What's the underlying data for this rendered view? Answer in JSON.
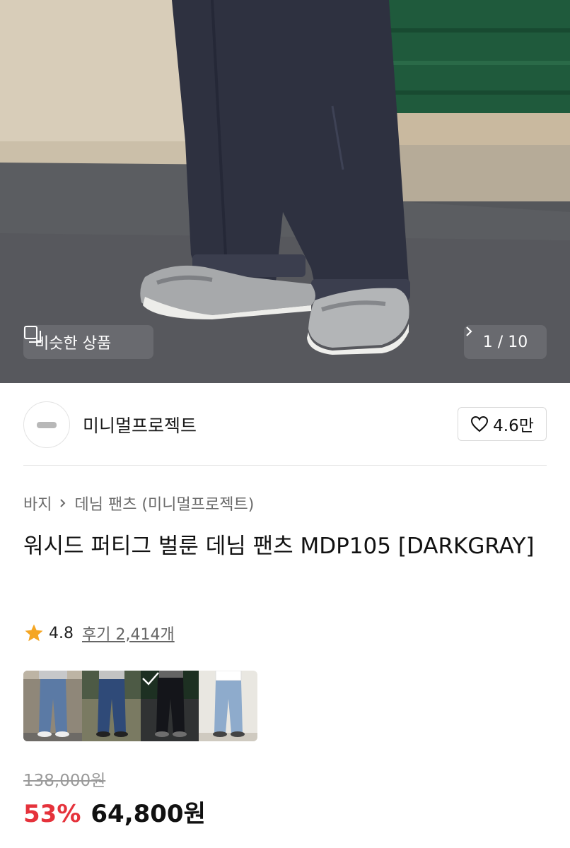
{
  "gallery": {
    "similar_label": "비슷한 상품",
    "counter": "1 / 10",
    "icons": [
      "similar-items-icon",
      "chevron-right-icon"
    ]
  },
  "seller": {
    "name": "미니멀프로젝트",
    "likes": "4.6만",
    "like_icon": "heart-outline-icon"
  },
  "breadcrumb": {
    "items": [
      "바지",
      "데님 팬츠 (미니멀프로젝트)"
    ],
    "separator_icon": "chevron-right-icon"
  },
  "product": {
    "title": "워시드 퍼티그 벌룬 데님 팬츠 MDP105 [DARKGRAY]"
  },
  "rating": {
    "score": "4.8",
    "reviews": "후기 2,414개",
    "star_color": "#F5A623"
  },
  "color_options": {
    "count": 4,
    "selected_index": 2,
    "selected_icon": "check-icon"
  },
  "price": {
    "original": "138,000원",
    "discount": "53%",
    "sale": "64,800원",
    "discount_color": "#E5323B"
  }
}
